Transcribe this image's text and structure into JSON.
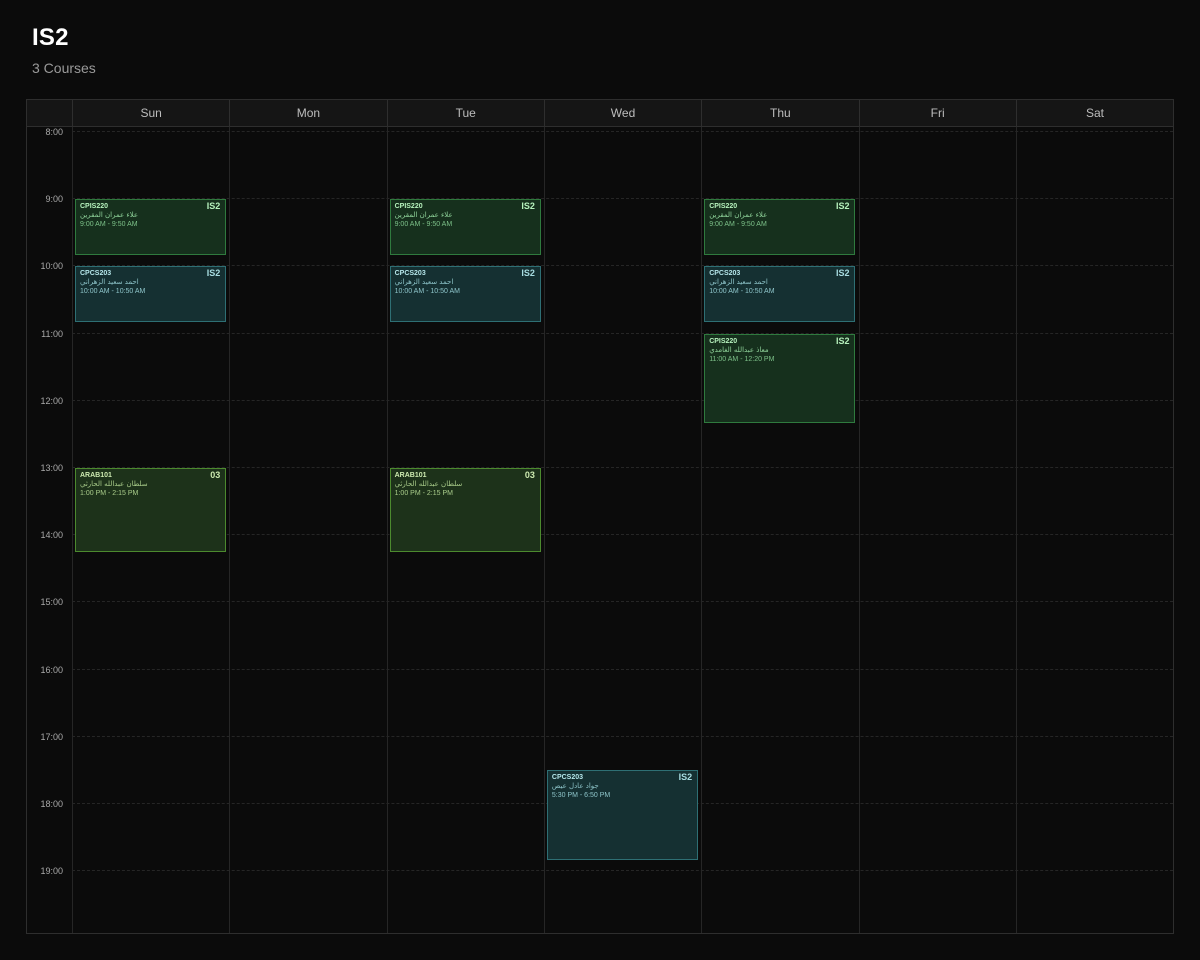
{
  "page": {
    "title": "IS2",
    "subtitle": "3 Courses"
  },
  "days": [
    "Sun",
    "Mon",
    "Tue",
    "Wed",
    "Thu",
    "Fri",
    "Sat"
  ],
  "hours": [
    "8:00",
    "9:00",
    "10:00",
    "11:00",
    "12:00",
    "13:00",
    "14:00",
    "15:00",
    "16:00",
    "17:00",
    "18:00",
    "19:00"
  ],
  "colors": {
    "background": "#0b0b0b",
    "green": "#16301d",
    "teal": "#153032",
    "olive": "#1d321a"
  },
  "events": [
    {
      "day": "Sun",
      "start": "9:00",
      "end": "9:50",
      "code": "CPIS220",
      "section": "IS2",
      "instructor": "علاء عمران المقرين",
      "time": "9:00 AM - 9:50 AM",
      "color": "green"
    },
    {
      "day": "Sun",
      "start": "10:00",
      "end": "10:50",
      "code": "CPCS203",
      "section": "IS2",
      "instructor": "احمد سعيد الزهراني",
      "time": "10:00 AM - 10:50 AM",
      "color": "teal"
    },
    {
      "day": "Sun",
      "start": "13:00",
      "end": "14:15",
      "code": "ARAB101",
      "section": "03",
      "instructor": "سلطان عبدالله الحارثي",
      "time": "1:00 PM - 2:15 PM",
      "color": "olive"
    },
    {
      "day": "Tue",
      "start": "9:00",
      "end": "9:50",
      "code": "CPIS220",
      "section": "IS2",
      "instructor": "علاء عمران المقرين",
      "time": "9:00 AM - 9:50 AM",
      "color": "green"
    },
    {
      "day": "Tue",
      "start": "10:00",
      "end": "10:50",
      "code": "CPCS203",
      "section": "IS2",
      "instructor": "احمد سعيد الزهراني",
      "time": "10:00 AM - 10:50 AM",
      "color": "teal"
    },
    {
      "day": "Tue",
      "start": "13:00",
      "end": "14:15",
      "code": "ARAB101",
      "section": "03",
      "instructor": "سلطان عبدالله الحارثي",
      "time": "1:00 PM - 2:15 PM",
      "color": "olive"
    },
    {
      "day": "Wed",
      "start": "17:30",
      "end": "18:50",
      "code": "CPCS203",
      "section": "IS2",
      "instructor": "جواد عادل عيص",
      "time": "5:30 PM - 6:50 PM",
      "color": "teal"
    },
    {
      "day": "Thu",
      "start": "9:00",
      "end": "9:50",
      "code": "CPIS220",
      "section": "IS2",
      "instructor": "علاء عمران المقرين",
      "time": "9:00 AM - 9:50 AM",
      "color": "green"
    },
    {
      "day": "Thu",
      "start": "10:00",
      "end": "10:50",
      "code": "CPCS203",
      "section": "IS2",
      "instructor": "احمد سعيد الزهراني",
      "time": "10:00 AM - 10:50 AM",
      "color": "teal"
    },
    {
      "day": "Thu",
      "start": "11:00",
      "end": "12:20",
      "code": "CPIS220",
      "section": "IS2",
      "instructor": "معاذ عبدالله الغامدي",
      "time": "11:00 AM - 12:20 PM",
      "color": "green"
    }
  ]
}
